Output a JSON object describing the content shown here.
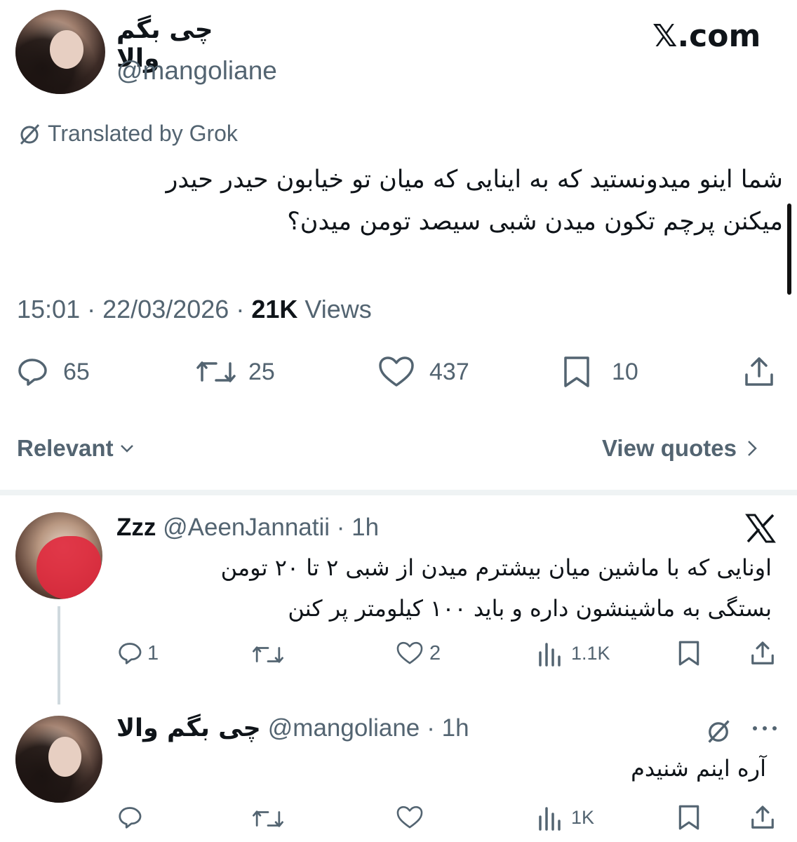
{
  "header": {
    "display_name": "چی بگم والا",
    "handle": "@mangoliane",
    "site": "𝕏.com"
  },
  "translation": {
    "label": "Translated by Grok"
  },
  "tweet": {
    "text_line1": "شما اینو میدونستید که به اینایی که میان تو خیابون حیدر حیدر",
    "text_line2": "میکنن پرچم تکون میدن شبی سیصد تومن میدن؟",
    "time": "15:01",
    "date": "22/03/2026",
    "views_count": "21K",
    "views_label": "Views",
    "separator": "·",
    "replies": "65",
    "reposts": "25",
    "likes": "437",
    "bookmarks": "10"
  },
  "sort": {
    "relevant_label": "Relevant",
    "view_quotes_label": "View quotes"
  },
  "replies": [
    {
      "name": "Zzz",
      "handle": "@AeenJannatii",
      "age": "· 1h",
      "text_line1": "اونایی که با ماشین میان بیشترم میدن از شبی ۲ تا ۲۰ تومن",
      "text_line2": "بستگی به ماشینشون داره و باید ۱۰۰ کیلومتر پر کنن",
      "replies": "1",
      "reposts": "",
      "likes": "2",
      "views": "1.1K"
    },
    {
      "name": "چی بگم والا",
      "handle": "@mangoliane",
      "age": "· 1h",
      "text_line1": "آره اینم شنیدم",
      "replies": "",
      "reposts": "",
      "likes": "",
      "views": "1K"
    }
  ],
  "icons": {
    "reply": "reply-icon",
    "repost": "repost-icon",
    "like": "heart-icon",
    "bookmark": "bookmark-icon",
    "share": "share-icon",
    "views": "views-icon",
    "x_logo": "x-logo-icon",
    "translate": "translate-icon",
    "more": "more-icon"
  },
  "colors": {
    "text": "#0f1419",
    "secondary": "#536471",
    "divider": "#eff3f4"
  }
}
